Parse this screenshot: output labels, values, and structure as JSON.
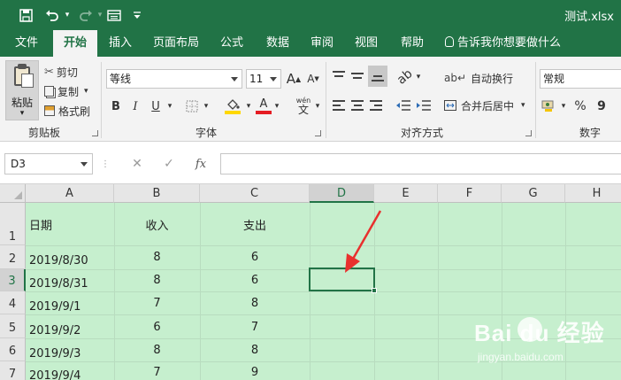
{
  "title_bar": {
    "filename": "测试.xlsx",
    "icons": [
      "save-icon",
      "undo-icon",
      "redo-icon",
      "form-icon",
      "customize-qat-icon"
    ]
  },
  "tabs": [
    {
      "label": "文件",
      "active": false
    },
    {
      "label": "开始",
      "active": true
    },
    {
      "label": "插入",
      "active": false
    },
    {
      "label": "页面布局",
      "active": false
    },
    {
      "label": "公式",
      "active": false
    },
    {
      "label": "数据",
      "active": false
    },
    {
      "label": "审阅",
      "active": false
    },
    {
      "label": "视图",
      "active": false
    },
    {
      "label": "帮助",
      "active": false
    }
  ],
  "tell_me": "告诉我你想要做什么",
  "ribbon": {
    "clipboard": {
      "paste": "粘贴",
      "cut": "剪切",
      "copy": "复制",
      "format_painter": "格式刷",
      "group_label": "剪贴板"
    },
    "font": {
      "font_name": "等线",
      "font_size": "11",
      "bold": "B",
      "italic": "I",
      "underline": "U",
      "font_color_letter": "A",
      "increase_size": "A",
      "decrease_size": "A",
      "phonetic": "wén",
      "phonetic_char": "文",
      "group_label": "字体",
      "fill_color": "#ffd800",
      "font_color": "#e51c23"
    },
    "alignment": {
      "wrap_text": "自动换行",
      "merge_center": "合并后居中",
      "group_label": "对齐方式"
    },
    "number": {
      "format": "常规",
      "percent": "%",
      "comma": "9",
      "group_label": "数字"
    }
  },
  "formula_bar": {
    "name_box": "D3",
    "cancel": "✕",
    "enter": "✓",
    "fx": "fx",
    "formula": ""
  },
  "sheet": {
    "columns": [
      "A",
      "B",
      "C",
      "D",
      "E",
      "F",
      "G",
      "H"
    ],
    "selected_column": "D",
    "rows": [
      "1",
      "2",
      "3",
      "4",
      "5",
      "6",
      "7"
    ],
    "selected_row": "3",
    "selected_cell": "D3",
    "headers": {
      "a": "日期",
      "b": "收入",
      "c": "支出"
    },
    "data": [
      {
        "date": "2019/8/30",
        "income": "8",
        "expense": "6"
      },
      {
        "date": "2019/8/31",
        "income": "8",
        "expense": "6"
      },
      {
        "date": "2019/9/1",
        "income": "7",
        "expense": "8"
      },
      {
        "date": "2019/9/2",
        "income": "6",
        "expense": "7"
      },
      {
        "date": "2019/9/3",
        "income": "8",
        "expense": "8"
      },
      {
        "date": "2019/9/4",
        "income": "7",
        "expense": "9"
      }
    ],
    "fill_color": "#c6efce",
    "accent": "#217346",
    "annotation_color": "#e8302e"
  },
  "watermark": {
    "logo": "Bai du 经验",
    "url": "jingyan.baidu.com"
  }
}
